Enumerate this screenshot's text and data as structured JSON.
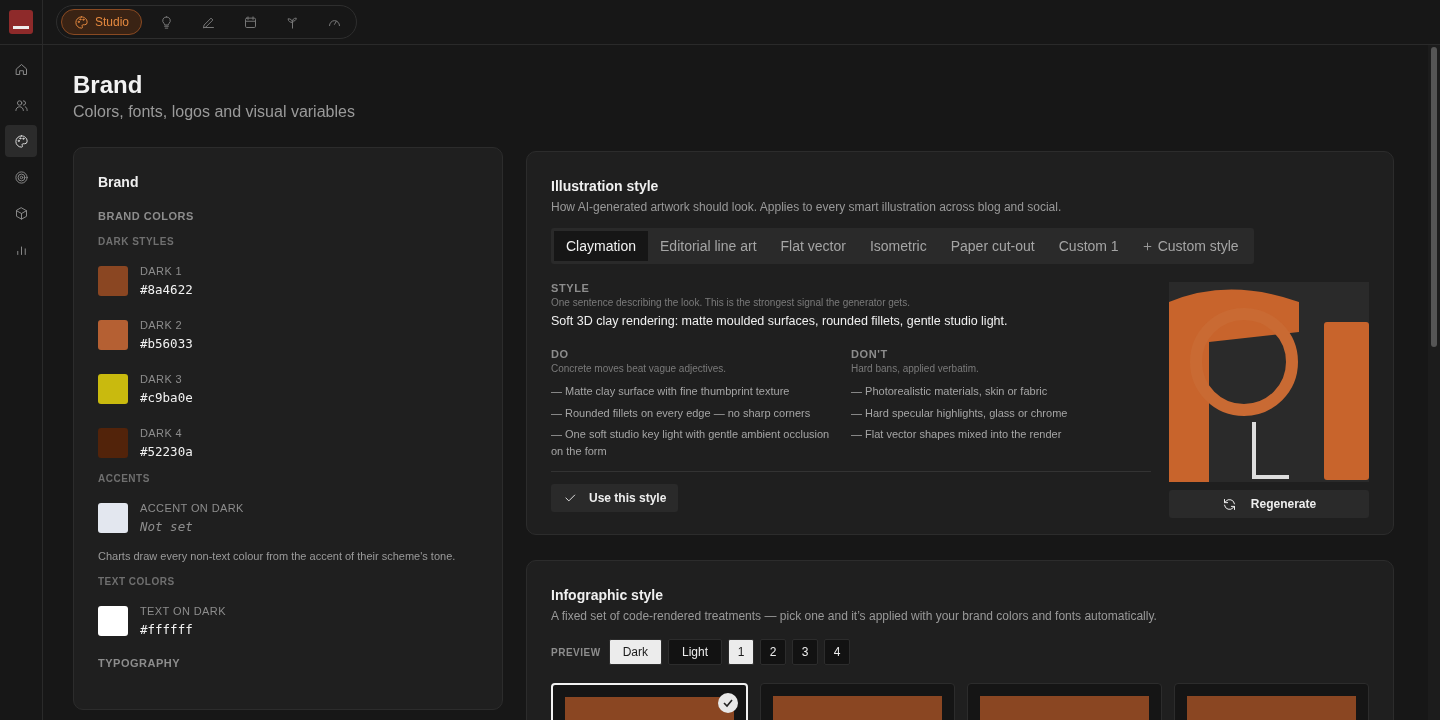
{
  "top_nav": [
    {
      "label": "Studio",
      "selected": true
    },
    {
      "selected": false
    },
    {
      "selected": false
    },
    {
      "selected": false
    },
    {
      "selected": false
    },
    {
      "selected": false
    }
  ],
  "sidebar": {
    "items": [
      {
        "selected": false
      },
      {
        "selected": false
      },
      {
        "selected": true
      },
      {
        "selected": false
      },
      {
        "selected": false
      },
      {
        "selected": false
      }
    ]
  },
  "page": {
    "title": "Brand",
    "subtitle": "Colors, fonts, logos and visual variables"
  },
  "brand_card": {
    "title": "Brand",
    "section": "BRAND COLORS",
    "groups": [
      {
        "heading": "DARK STYLES",
        "colors": [
          {
            "name": "DARK 1",
            "value": "#8a4622",
            "color": "#8a4622",
            "set": true
          },
          {
            "name": "DARK 2",
            "value": "#b56033",
            "color": "#b56033",
            "set": true
          },
          {
            "name": "DARK 3",
            "value": "#c9ba0e",
            "color": "#c9ba0e",
            "set": true
          },
          {
            "name": "DARK 4",
            "value": "#52230a",
            "color": "#52230a",
            "set": true
          }
        ]
      },
      {
        "heading": "ACCENTS",
        "colors": [
          {
            "name": "ACCENT ON DARK",
            "value": "Not set",
            "color": "#e3e7ef",
            "set": false
          }
        ],
        "note": "Charts draw every non-text colour from the accent of their scheme's tone."
      },
      {
        "heading": "TEXT COLORS",
        "colors": [
          {
            "name": "TEXT ON DARK",
            "value": "#ffffff",
            "color": "#ffffff",
            "set": true
          }
        ]
      }
    ],
    "next_section": "TYPOGRAPHY"
  },
  "illustration": {
    "title": "Illustration style",
    "description": "How AI-generated artwork should look. Applies to every smart illustration across blog and social.",
    "tabs": [
      {
        "label": "Claymation",
        "selected": true
      },
      {
        "label": "Editorial line art",
        "selected": false
      },
      {
        "label": "Flat vector",
        "selected": false
      },
      {
        "label": "Isometric",
        "selected": false
      },
      {
        "label": "Paper cut-out",
        "selected": false
      },
      {
        "label": "Custom 1",
        "selected": false
      }
    ],
    "add_tab": "Custom style",
    "style": {
      "label": "STYLE",
      "hint": "One sentence describing the look. This is the strongest signal the generator gets.",
      "value": "Soft 3D clay rendering: matte moulded surfaces, rounded fillets, gentle studio light."
    },
    "do": {
      "label": "DO",
      "hint": "Concrete moves beat vague adjectives.",
      "items": [
        "— Matte clay surface with fine thumbprint texture",
        "— Rounded fillets on every edge — no sharp corners",
        "— One soft studio key light with gentle ambient occlusion on the form"
      ]
    },
    "dont": {
      "label": "DON'T",
      "hint": "Hard bans, applied verbatim.",
      "items": [
        "— Photorealistic materials, skin or fabric",
        "— Hard specular highlights, glass or chrome",
        "— Flat vector shapes mixed into the render"
      ]
    },
    "use_button": "Use this style",
    "regenerate_button": "Regenerate"
  },
  "infographic": {
    "title": "Infographic style",
    "description": "A fixed set of code-rendered treatments — pick one and it’s applied with your brand colors and fonts automatically.",
    "preview_label": "PREVIEW",
    "modes": [
      {
        "label": "Dark",
        "selected": true
      },
      {
        "label": "Light",
        "selected": false
      }
    ],
    "pages": [
      {
        "label": "1",
        "selected": true
      },
      {
        "label": "2",
        "selected": false
      },
      {
        "label": "3",
        "selected": false
      },
      {
        "label": "4",
        "selected": false
      }
    ],
    "treatments": [
      {
        "selected": true
      },
      {
        "selected": false
      },
      {
        "selected": false
      },
      {
        "selected": false
      }
    ]
  }
}
